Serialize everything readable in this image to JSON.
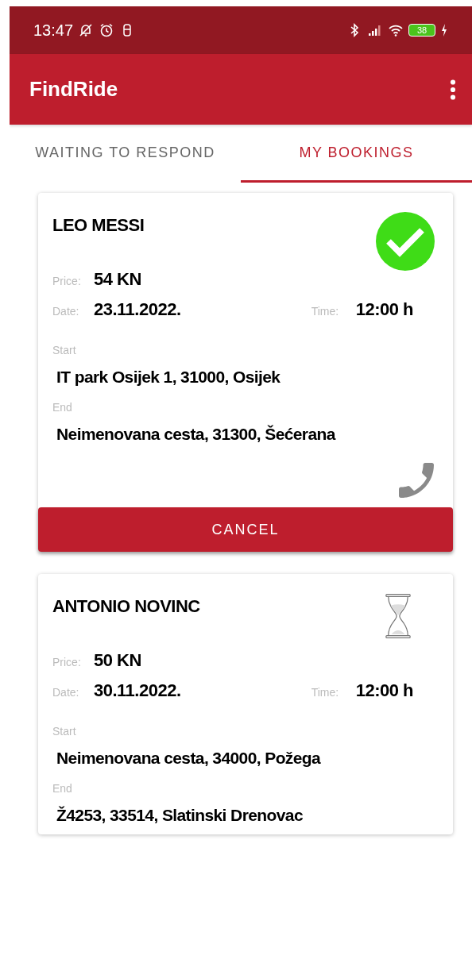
{
  "status_bar": {
    "time": "13:47",
    "battery": "38"
  },
  "app_bar": {
    "title": "FindRide"
  },
  "tabs": [
    {
      "label": "WAITING TO RESPOND",
      "selected": false
    },
    {
      "label": "MY BOOKINGS",
      "selected": true
    }
  ],
  "bookings": [
    {
      "name": "LEO MESSI",
      "kind": "accepted",
      "price_label": "Price:",
      "price": "54 KN",
      "date_label": "Date:",
      "date": "23.11.2022.",
      "time_label": "Time:",
      "time": "12:00 h",
      "start_label": "Start",
      "start": "IT park Osijek 1, 31000, Osijek",
      "end_label": "End",
      "end": "Neimenovana cesta, 31300, Šećerana",
      "call": true,
      "button": "CANCEL"
    },
    {
      "name": "ANTONIO  NOVINC",
      "kind": "pending",
      "price_label": "Price:",
      "price": "50 KN",
      "date_label": "Date:",
      "date": "30.11.2022.",
      "time_label": "Time:",
      "time": "12:00 h",
      "start_label": "Start",
      "start": "Neimenovana cesta, 34000, Požega",
      "end_label": "End",
      "end": "Ž4253, 33514, Slatinski Drenovac"
    }
  ]
}
